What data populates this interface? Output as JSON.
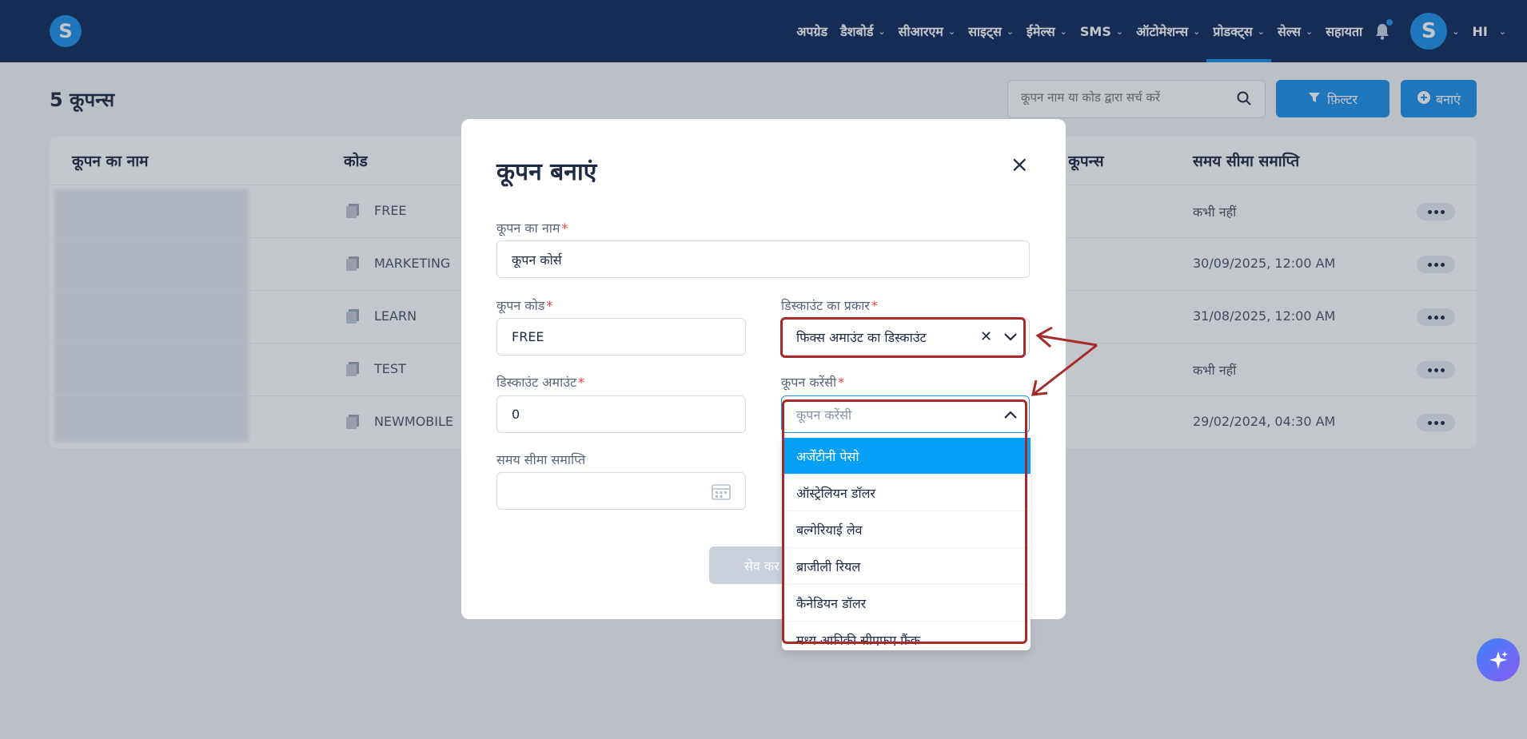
{
  "nav": {
    "logo": "S",
    "items": [
      {
        "label": "अपग्रेड",
        "has_chevron": false
      },
      {
        "label": "डैशबोर्ड",
        "has_chevron": true
      },
      {
        "label": "सीआरएम",
        "has_chevron": true
      },
      {
        "label": "साइट्स",
        "has_chevron": true
      },
      {
        "label": "ईमेल्स",
        "has_chevron": true
      },
      {
        "label": "SMS",
        "has_chevron": true
      },
      {
        "label": "ऑटोमेशन्स",
        "has_chevron": true
      },
      {
        "label": "प्रोडक्ट्स",
        "has_chevron": true,
        "active": true
      },
      {
        "label": "सेल्स",
        "has_chevron": true
      },
      {
        "label": "सहायता",
        "has_chevron": false
      }
    ],
    "avatar": "S",
    "language": "HI"
  },
  "page": {
    "title": "5 कूपन्स",
    "search_placeholder": "कूपन नाम या कोड द्वारा सर्च करें",
    "filter_label": "फ़िल्टर",
    "create_label": "बनाएं"
  },
  "table": {
    "headers": {
      "name": "कूपन का नाम",
      "code": "कोड",
      "valid": "ध कूपन्स",
      "expiry": "समय सीमा समाप्ति"
    },
    "rows": [
      {
        "code": "FREE",
        "expiry": "कभी नहीं"
      },
      {
        "code": "MARKETING",
        "expiry": "30/09/2025, 12:00 AM"
      },
      {
        "code": "LEARN",
        "expiry": "31/08/2025, 12:00 AM"
      },
      {
        "code": "TEST",
        "expiry": "कभी नहीं"
      },
      {
        "code": "NEWMOBILE",
        "expiry": "29/02/2024, 04:30 AM"
      }
    ]
  },
  "modal": {
    "title": "कूपन बनाएं",
    "close": "×",
    "coupon_name_label": "कूपन का नाम",
    "coupon_name_value": "कूपन कोर्स",
    "coupon_code_label": "कूपन कोड",
    "coupon_code_value": "FREE",
    "discount_type_label": "डिस्काउंट का प्रकार",
    "discount_type_value": "फिक्स अमाउंट का डिस्काउंट",
    "discount_amount_label": "डिस्काउंट अमाउंट",
    "discount_amount_value": "0",
    "currency_label": "कूपन करेंसी",
    "currency_placeholder": "कूपन करेंसी",
    "expiry_label": "समय सीमा समाप्ति",
    "save_label": "सेव कर"
  },
  "currency_options": [
    "अर्जेंटीनी पेसो",
    "ऑस्ट्रेलियन डॉलर",
    "बल्गेरियाई लेव",
    "ब्राजीली रियल",
    "कैनेडियन डॉलर",
    "मध्य अफ्रीकी सीएफए फ्रैंक"
  ],
  "colors": {
    "nav_bg": "#0e2a5c",
    "primary": "#1e90e8",
    "dropdown_active": "#06a0f7",
    "annotation": "#a52a2a"
  }
}
